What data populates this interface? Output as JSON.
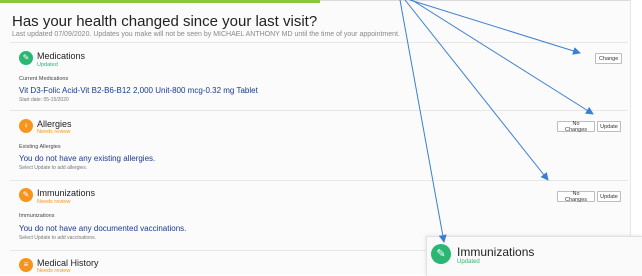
{
  "page": {
    "title": "Has your health changed since your last visit?",
    "subtitle": "Last updated 07/09/2020. Updates you make will not be seen by MICHAEL ANTHONY MD until the time of your appointment."
  },
  "colors": {
    "accent_green": "#2bb673",
    "accent_orange": "#f7941d",
    "content_blue": "#1a3a8f",
    "arrow_blue": "#3b7fd4"
  },
  "medications": {
    "name": "Medications",
    "status": "Updated",
    "icon": "pill-icon",
    "list_label": "Current Medications",
    "item": "Vit D3-Folic Acid-Vit B2-B6-B12 2,000 Unit-800 mcg-0.32 mg Tablet",
    "start_date": "Start date: 05-15/2020",
    "change_label": "Change"
  },
  "allergies": {
    "name": "Allergies",
    "status": "Needs review",
    "icon": "allergy-icon",
    "list_label": "Existing Allergies",
    "message": "You do not have any existing allergies.",
    "help": "Select Update to add allergies.",
    "no_changes_label": "No Changes",
    "update_label": "Update"
  },
  "immunizations": {
    "name": "Immunizations",
    "status": "Needs review",
    "icon": "syringe-icon",
    "list_label": "Immunizations",
    "message": "You do not have any documented vaccinations.",
    "help": "Select Update to add vaccinations.",
    "no_changes_label": "No Changes",
    "update_label": "Update"
  },
  "medical_history": {
    "name": "Medical History",
    "status": "Needs review",
    "icon": "history-icon"
  },
  "popup": {
    "name": "Immunizations",
    "status": "Updated",
    "icon": "syringe-icon"
  }
}
